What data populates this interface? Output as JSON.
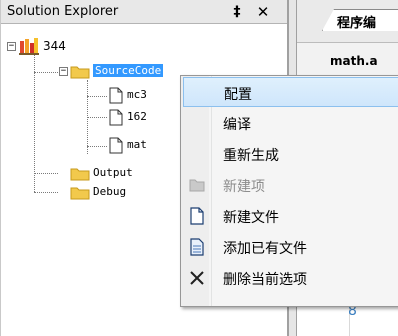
{
  "panel": {
    "title": "Solution Explorer",
    "pin_glyph": "‡",
    "close_glyph": "✕"
  },
  "tree": {
    "project": {
      "label": "344",
      "icon": "project-icon"
    },
    "folders": [
      {
        "label": "SourceCode",
        "icon": "folder-icon",
        "expanded": true,
        "selected": true
      },
      {
        "label": "Output",
        "icon": "folder-icon"
      },
      {
        "label": "Debug",
        "icon": "folder-icon"
      }
    ],
    "files": [
      {
        "label": "mc3",
        "icon": "file-icon"
      },
      {
        "label": "162",
        "icon": "file-icon"
      },
      {
        "label": "mat",
        "icon": "file-icon"
      }
    ]
  },
  "editor": {
    "tab_label": "程序编",
    "file_tab": "math.a",
    "line_number": "8"
  },
  "context_menu": {
    "items": [
      {
        "label": "配置",
        "icon": "",
        "enabled": true,
        "highlighted": true
      },
      {
        "label": "编译",
        "icon": "",
        "enabled": true
      },
      {
        "label": "重新生成",
        "icon": "",
        "enabled": true
      },
      {
        "label": "新建项",
        "icon": "folder-icon",
        "enabled": false
      },
      {
        "label": "新建文件",
        "icon": "new-file-icon",
        "enabled": true
      },
      {
        "label": "添加已有文件",
        "icon": "existing-file-icon",
        "enabled": true
      },
      {
        "label": "删除当前选项",
        "icon": "delete-x-icon",
        "enabled": true
      }
    ]
  },
  "colors": {
    "selection": "#3399ff",
    "menu_highlight_border": "#8cc0ee",
    "folder": "#f2c94c"
  }
}
